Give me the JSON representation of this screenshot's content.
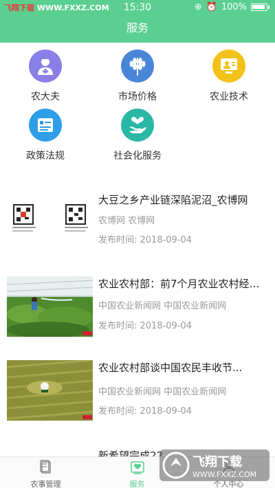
{
  "statusbar": {
    "site_brand": "飞翔下载",
    "site_url": "WWW.FXXZ.COM",
    "time": "15:30",
    "battery": "100%"
  },
  "header": {
    "title": "服务"
  },
  "services": [
    {
      "label": "农大夫",
      "icon": "doctor-icon",
      "color": "#8a7fe6"
    },
    {
      "label": "市场价格",
      "icon": "wheat-icon",
      "color": "#4a86d8"
    },
    {
      "label": "农业技术",
      "icon": "presentation-icon",
      "color": "#f2c21a"
    },
    {
      "label": "政策法规",
      "icon": "document-icon",
      "color": "#2f9ee8"
    },
    {
      "label": "社会化服务",
      "icon": "hand-heart-icon",
      "color": "#2ab7a6"
    }
  ],
  "news": [
    {
      "title": "大豆之乡产业链深陷泥沼_农博网",
      "source": "农博网 农博网",
      "date": "发布时间: 2018-09-04"
    },
    {
      "title": "农业农村部：前7个月农业农村经济...",
      "source": "中国农业新闻网 中国农业新闻网",
      "date": "发布时间: 2018-09-04"
    },
    {
      "title": "农业农村部谈中国农民丰收节...",
      "source": "中国农业新闻网 中国农业新闻网",
      "date": "发布时间: 2018-09-04"
    },
    {
      "title": "新希望完成22",
      "source": "",
      "date": ""
    }
  ],
  "tabbar": [
    {
      "label": "农事管理",
      "icon": "notebook-icon"
    },
    {
      "label": "服务",
      "icon": "service-icon"
    },
    {
      "label": "个人中心",
      "icon": "user-icon"
    }
  ],
  "watermark": {
    "brand": "飞翔下载",
    "url": "WWW.FXXZ.COM"
  },
  "colors": {
    "accent": "#5bcf8f",
    "active_tab": "#5bcf8f"
  }
}
